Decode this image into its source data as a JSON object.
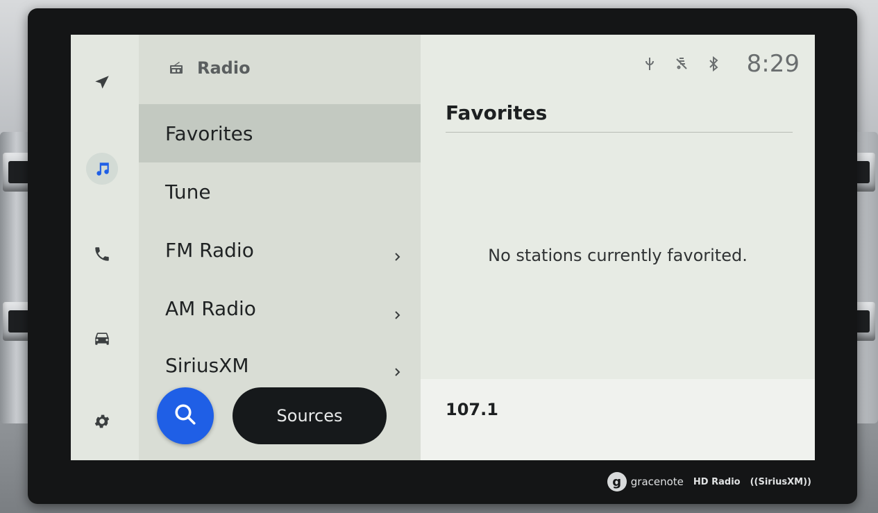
{
  "status": {
    "clock": "8:29",
    "icons": [
      "wireless-charging-icon",
      "mute-icon",
      "bluetooth-icon"
    ]
  },
  "header": {
    "title": "Radio",
    "icon": "radio-icon"
  },
  "rail": {
    "items": [
      {
        "name": "navigation-icon",
        "active": false
      },
      {
        "name": "music-note-icon",
        "active": true
      },
      {
        "name": "phone-icon",
        "active": false
      },
      {
        "name": "car-icon",
        "active": false
      },
      {
        "name": "gear-icon",
        "active": false
      }
    ],
    "accent": "#1f5fe6"
  },
  "menu": {
    "items": [
      {
        "label": "Favorites",
        "selected": true,
        "has_chevron": false
      },
      {
        "label": "Tune",
        "selected": false,
        "has_chevron": false
      },
      {
        "label": "FM Radio",
        "selected": false,
        "has_chevron": true
      },
      {
        "label": "AM Radio",
        "selected": false,
        "has_chevron": true
      },
      {
        "label": "SiriusXM",
        "selected": false,
        "has_chevron": true
      }
    ]
  },
  "buttons": {
    "search_icon": "search-icon",
    "sources_label": "Sources"
  },
  "content": {
    "title": "Favorites",
    "empty_message": "No stations currently favorited."
  },
  "now_playing": {
    "frequency": "107.1"
  },
  "bezel_logos": {
    "gracenote": "gracenote",
    "hd_radio": "HD Radio",
    "siriusxm": "((SiriusXM))"
  },
  "colors": {
    "accent_blue": "#1f5fe6",
    "selected_row": "#c3c9c1",
    "sources_button": "#16191b"
  }
}
